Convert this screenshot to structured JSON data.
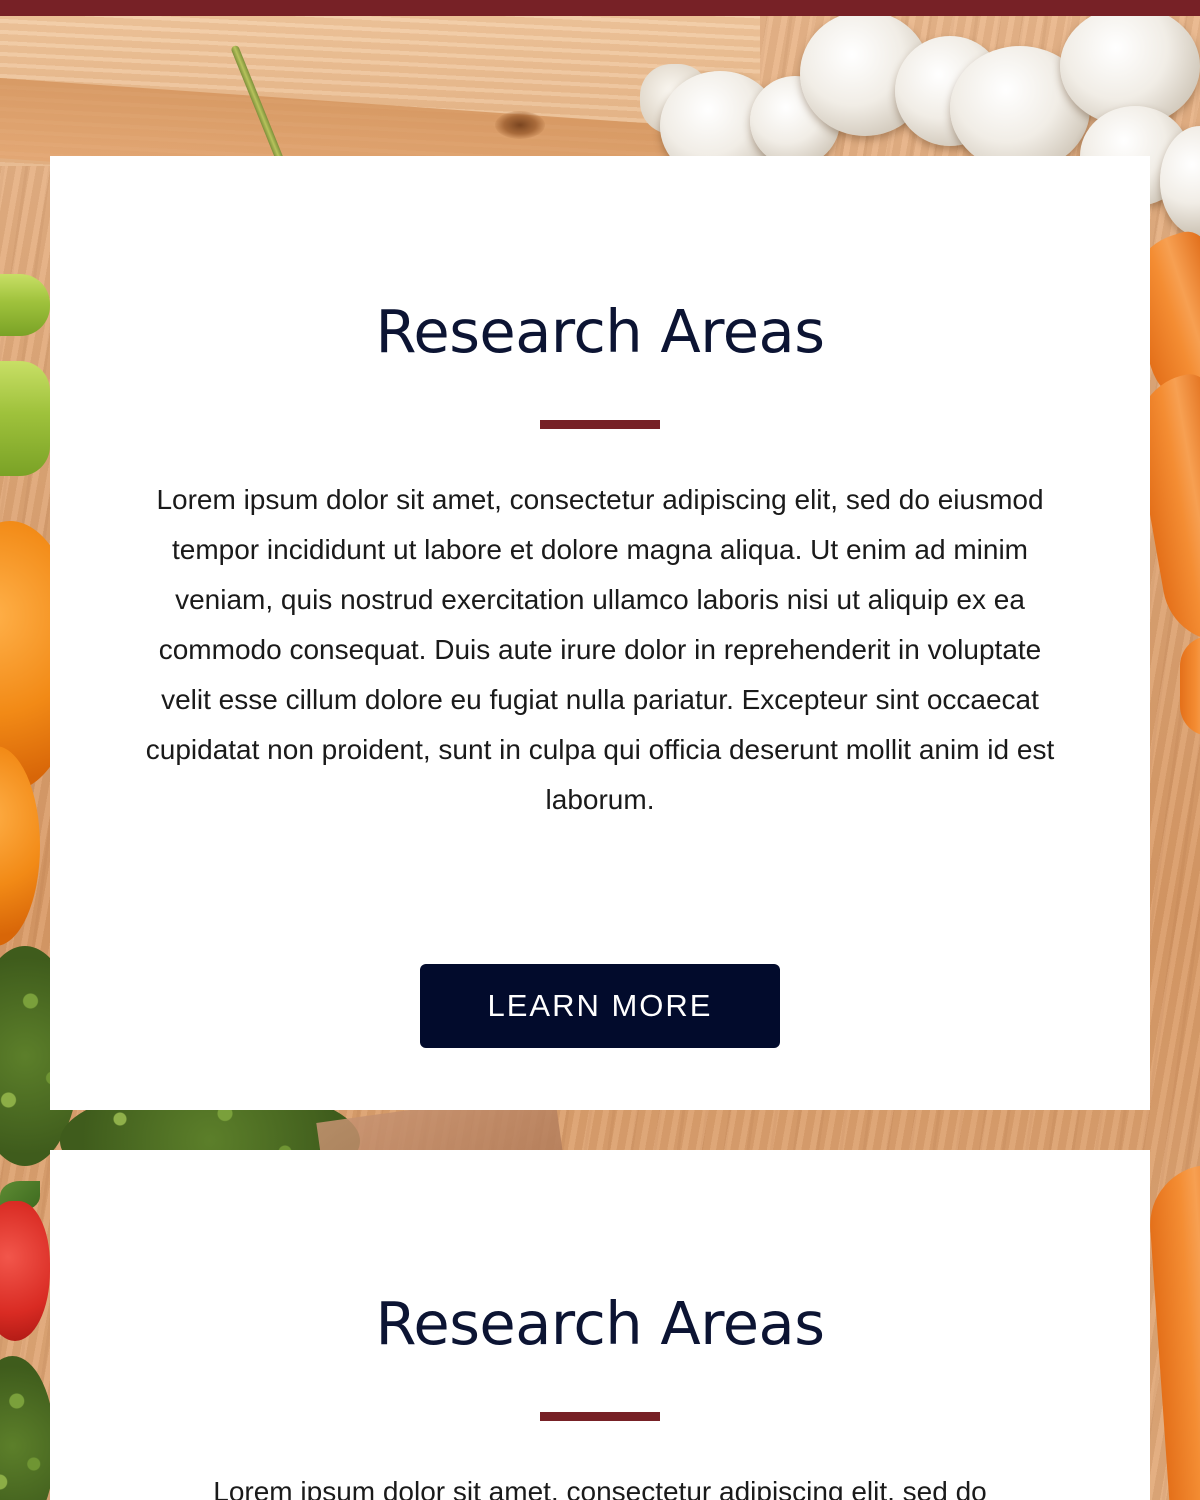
{
  "theme": {
    "accent": "#772126",
    "heading_color": "#0c1433",
    "button_bg": "#020b2c",
    "card_bg": "#ffffff"
  },
  "sections": [
    {
      "title": "Research Areas",
      "body": "Lorem ipsum dolor sit amet, consectetur adipiscing elit, sed do eiusmod tempor incididunt ut labore et dolore magna aliqua. Ut enim ad minim veniam, quis nostrud exercitation ullamco laboris nisi ut aliquip ex ea commodo consequat. Duis aute irure dolor in reprehenderit in voluptate velit esse cillum dolore eu fugiat nulla pariatur. Excepteur sint occaecat cupidatat non proident, sunt in culpa qui officia deserunt mollit anim id est laborum.",
      "button_label": "LEARN MORE"
    },
    {
      "title": "Research Areas",
      "body": "Lorem ipsum dolor sit amet, consectetur adipiscing elit, sed do"
    }
  ]
}
